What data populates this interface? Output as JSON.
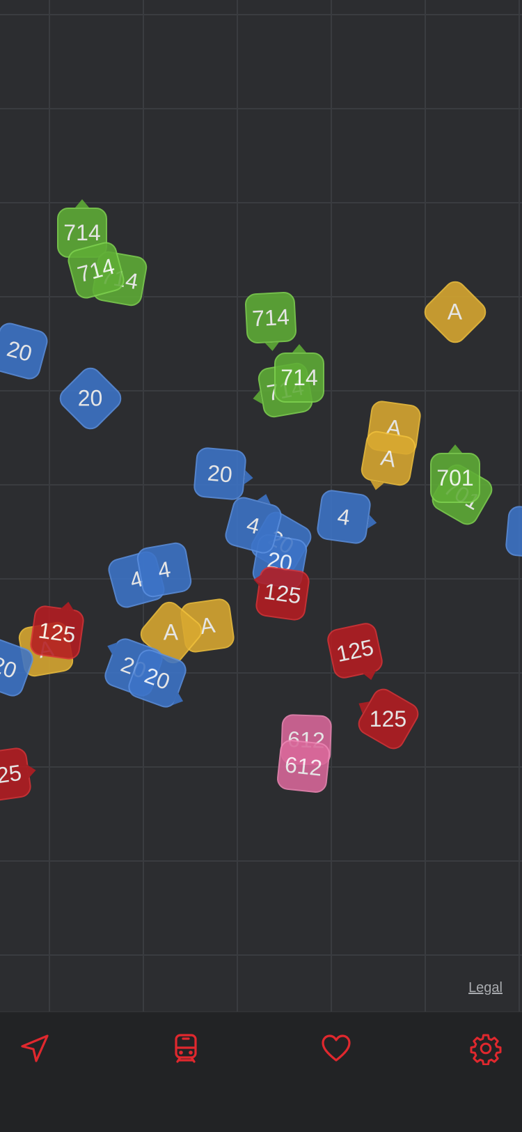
{
  "map": {
    "legal_label": "Legal",
    "markers": [
      {
        "label": "714",
        "color": "green"
      },
      {
        "label": "714",
        "color": "green"
      },
      {
        "label": "714",
        "color": "green"
      },
      {
        "label": "714",
        "color": "green"
      },
      {
        "label": "714",
        "color": "green"
      },
      {
        "label": "714",
        "color": "green"
      },
      {
        "label": "A",
        "color": "yellow"
      },
      {
        "label": "20",
        "color": "blue"
      },
      {
        "label": "20",
        "color": "blue"
      },
      {
        "label": "A",
        "color": "yellow"
      },
      {
        "label": "A",
        "color": "yellow"
      },
      {
        "label": "701",
        "color": "green"
      },
      {
        "label": "701",
        "color": "green"
      },
      {
        "label": "20",
        "color": "blue"
      },
      {
        "label": "4",
        "color": "blue"
      },
      {
        "label": "20",
        "color": "blue"
      },
      {
        "label": "20",
        "color": "blue"
      },
      {
        "label": "4",
        "color": "blue"
      },
      {
        "label": "4",
        "color": "blue"
      },
      {
        "label": "4",
        "color": "blue"
      },
      {
        "label": "125",
        "color": "red"
      },
      {
        "label": "A",
        "color": "yellow"
      },
      {
        "label": "A",
        "color": "yellow"
      },
      {
        "label": "125",
        "color": "red"
      },
      {
        "label": "A",
        "color": "yellow"
      },
      {
        "label": "20",
        "color": "blue"
      },
      {
        "label": "20",
        "color": "blue"
      },
      {
        "label": "20",
        "color": "blue"
      },
      {
        "label": "125",
        "color": "red"
      },
      {
        "label": "125",
        "color": "red"
      },
      {
        "label": "612",
        "color": "pink"
      },
      {
        "label": "612",
        "color": "pink"
      },
      {
        "label": "25",
        "color": "red"
      }
    ]
  },
  "tabbar": {
    "items": [
      {
        "name": "location",
        "icon": "navigation-arrow-icon"
      },
      {
        "name": "departures",
        "icon": "train-icon"
      },
      {
        "name": "favorites",
        "icon": "heart-icon"
      },
      {
        "name": "settings",
        "icon": "gear-icon"
      }
    ],
    "accent_color": "#e0282e"
  }
}
